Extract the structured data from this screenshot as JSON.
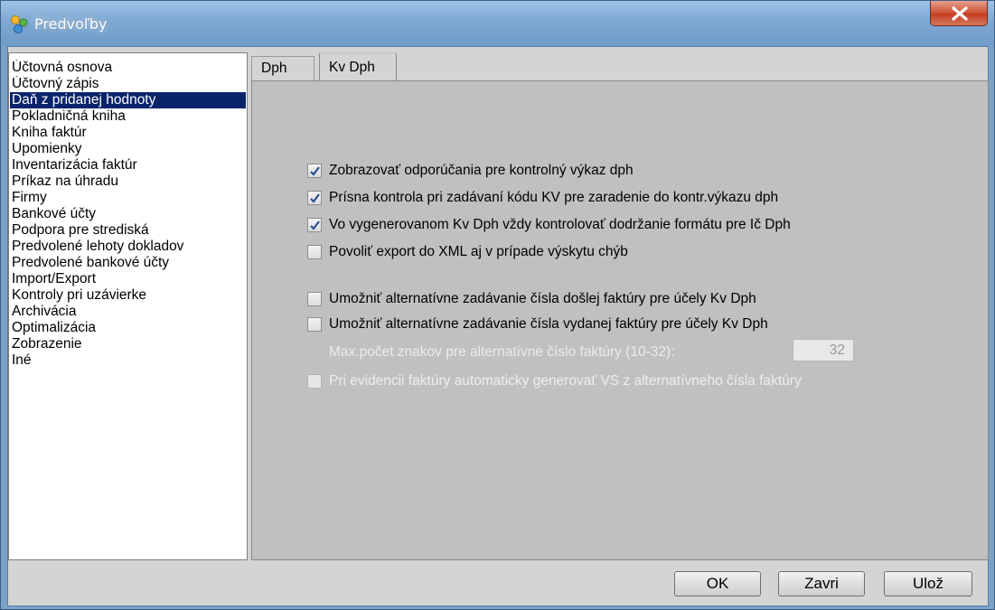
{
  "window": {
    "title": "Predvoľby",
    "accent_color": "#0a246a",
    "close_icon": "close-icon",
    "app_icon": "preferences-icon"
  },
  "sidebar": {
    "selected_index": 2,
    "items": [
      {
        "label": "Účtovná osnova"
      },
      {
        "label": "Účtovný zápis"
      },
      {
        "label": "Daň z pridanej hodnoty"
      },
      {
        "label": "Pokladničná kniha"
      },
      {
        "label": "Kniha faktúr"
      },
      {
        "label": "Upomienky"
      },
      {
        "label": "Inventarizácia faktúr"
      },
      {
        "label": "Príkaz na úhradu"
      },
      {
        "label": "Firmy"
      },
      {
        "label": "Bankové účty"
      },
      {
        "label": "Podpora pre strediská"
      },
      {
        "label": "Predvolené lehoty dokladov"
      },
      {
        "label": "Predvolené bankové účty"
      },
      {
        "label": "Import/Export"
      },
      {
        "label": "Kontroly pri uzávierke"
      },
      {
        "label": "Archivácia"
      },
      {
        "label": "Optimalizácia"
      },
      {
        "label": "Zobrazenie"
      },
      {
        "label": "Iné"
      }
    ]
  },
  "tabs": [
    {
      "label": "Dph",
      "active": false
    },
    {
      "label": "Kv Dph",
      "active": true
    }
  ],
  "kvdph": {
    "options": [
      {
        "label": "Zobrazovať odporúčania pre kontrolný výkaz dph",
        "checked": true,
        "enabled": true
      },
      {
        "label": "Prísna kontrola pri zadávaní kódu KV pre zaradenie do kontr.výkazu dph",
        "checked": true,
        "enabled": true
      },
      {
        "label": "Vo vygenerovanom Kv Dph vždy kontrolovať dodržanie formátu pre Ič Dph",
        "checked": true,
        "enabled": true
      },
      {
        "label": "Povoliť export do XML aj v prípade výskytu chýb",
        "checked": false,
        "enabled": true
      },
      {
        "label": "Umožniť alternatívne zadávanie čísla došlej faktúry pre účely Kv Dph",
        "checked": false,
        "enabled": true
      },
      {
        "label": "Umožniť alternatívne zadávanie čísla vydanej faktúry pre účely Kv Dph",
        "checked": false,
        "enabled": true
      },
      {
        "label": "Pri evidencii faktúry automaticky generovať VS z alternatívneho čísla faktúry",
        "checked": false,
        "enabled": false
      }
    ],
    "max_chars_label": "Max.počet znakov pre alternatívne číslo faktúry (10-32):",
    "max_chars_value": "32"
  },
  "buttons": {
    "ok": "OK",
    "close": "Zavri",
    "save": "Ulož"
  }
}
